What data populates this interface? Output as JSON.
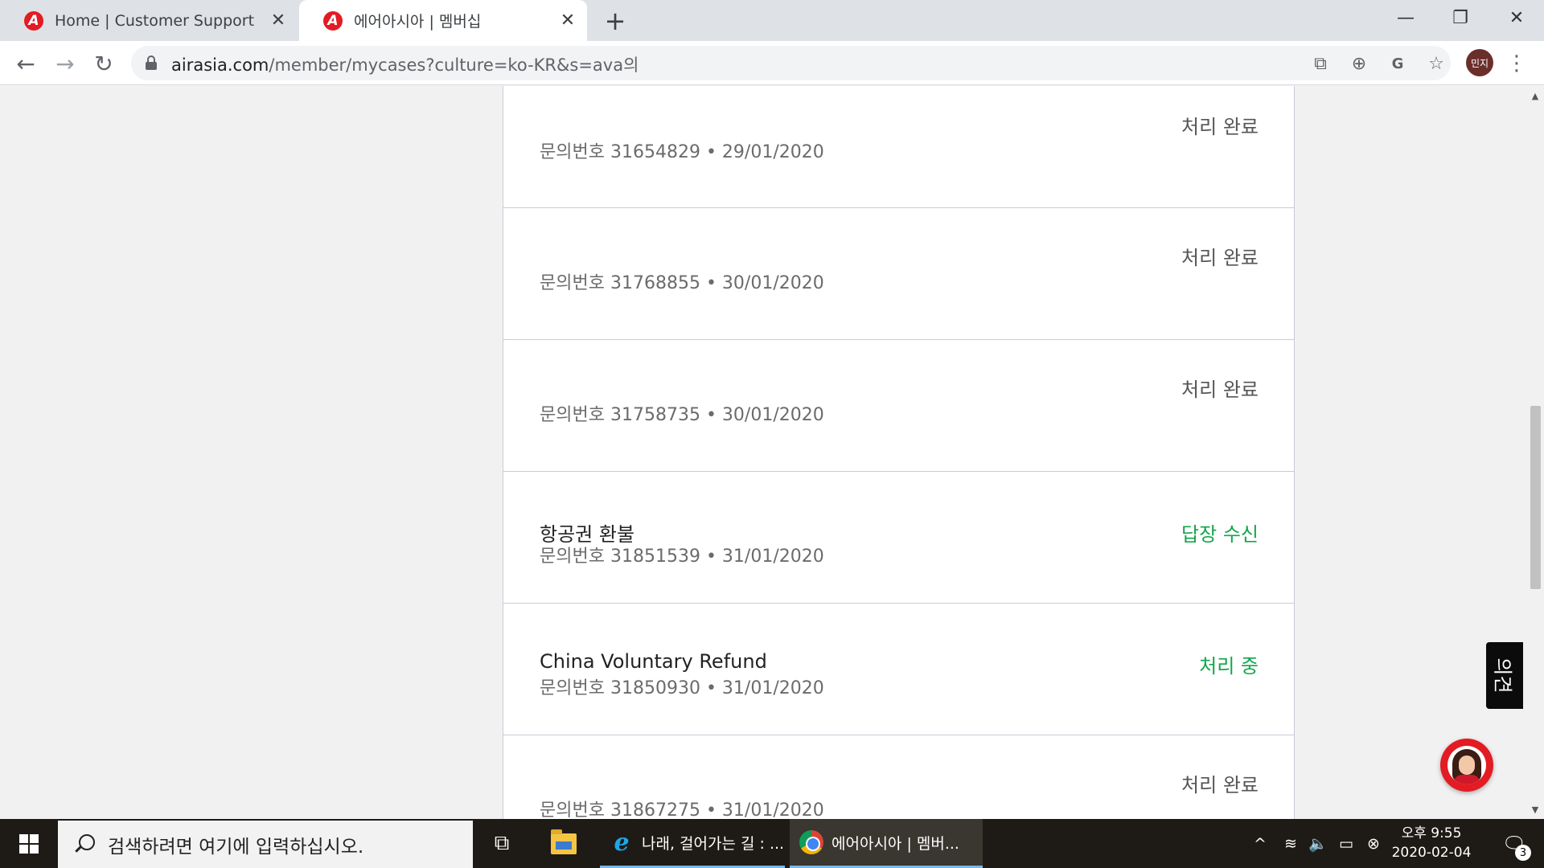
{
  "browser": {
    "tabs": [
      {
        "title": "Home | Customer Support",
        "active": false,
        "favicon": "airasia-logo"
      },
      {
        "title": "에어아시아 | 멤버십",
        "active": true,
        "favicon": "airasia-logo"
      }
    ],
    "favicon_glyph": "A",
    "close_glyph": "✕",
    "new_tab_glyph": "+",
    "window_controls": {
      "minimize": "—",
      "restore": "❐",
      "close": "✕"
    },
    "nav": {
      "back": "←",
      "forward": "→",
      "reload": "↻"
    },
    "url_host": "airasia.com",
    "url_path": "/member/mycases?culture=ko-KR&s=ava의",
    "omnibox_icons": {
      "open_external": "⧉",
      "add": "⊕",
      "translate": "G",
      "bookmark": "☆"
    },
    "profile_label": "민지",
    "menu_glyph": "⋮"
  },
  "cases": [
    {
      "subject": "",
      "case_label": "문의번호",
      "case_number": "31654829",
      "date": "29/01/2020",
      "status": "처리 완료",
      "status_color": "#555555"
    },
    {
      "subject": "",
      "case_label": "문의번호",
      "case_number": "31768855",
      "date": "30/01/2020",
      "status": "처리 완료",
      "status_color": "#555555"
    },
    {
      "subject": "",
      "case_label": "문의번호",
      "case_number": "31758735",
      "date": "30/01/2020",
      "status": "처리 완료",
      "status_color": "#555555"
    },
    {
      "subject": "항공권 환불",
      "case_label": "문의번호",
      "case_number": "31851539",
      "date": "31/01/2020",
      "status": "답장 수신",
      "status_color": "#12a64b"
    },
    {
      "subject": "China Voluntary Refund",
      "case_label": "문의번호",
      "case_number": "31850930",
      "date": "31/01/2020",
      "status": "처리 중",
      "status_color": "#12a64b"
    },
    {
      "subject": "",
      "case_label": "문의번호",
      "case_number": "31867275",
      "date": "31/01/2020",
      "status": "처리 완료",
      "status_color": "#555555"
    }
  ],
  "meta_separator": " • ",
  "feedback_tab": {
    "label": "의견"
  },
  "taskbar": {
    "search_placeholder": "검색하려면 여기에 입력하십시오.",
    "apps": [
      {
        "label": "나래, 걸어가는 길 : ...",
        "icon": "internet-explorer-icon",
        "ie_glyph": "e"
      },
      {
        "label": "에어아시아 | 멤버...",
        "icon": "chrome-icon"
      }
    ],
    "tray": {
      "chevron": "^",
      "wifi": "≋",
      "volume": "🔈",
      "battery": "▭",
      "close_circle": "⊗"
    },
    "clock_time": "오후 9:55",
    "clock_date": "2020-02-04",
    "notification_count": "3",
    "notification_glyph": "🗨",
    "task_view_glyph": "⧉"
  },
  "colors": {
    "brand_red": "#e31b23",
    "status_green": "#12a64b",
    "taskbar_bg": "#1e1b16"
  }
}
